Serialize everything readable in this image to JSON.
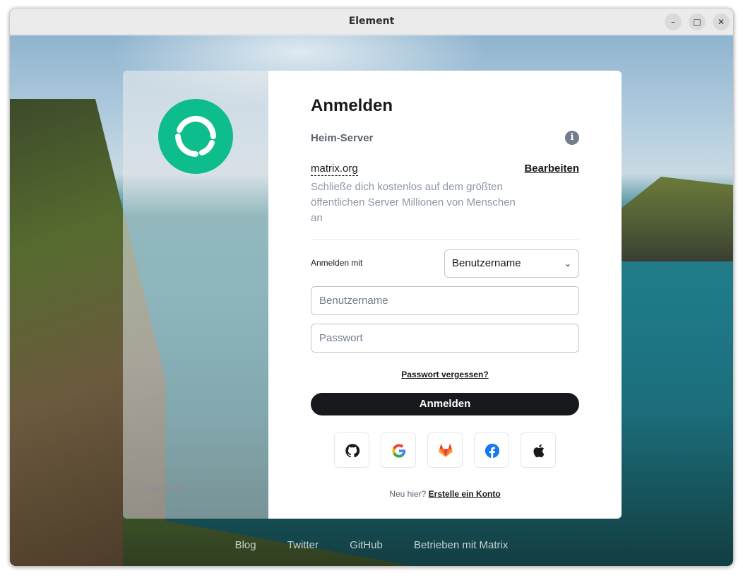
{
  "window": {
    "title": "Element",
    "minimize_glyph": "–",
    "maximize_glyph": "□",
    "close_glyph": "✕"
  },
  "sidebar": {
    "language": "Deutsch"
  },
  "login": {
    "heading": "Anmelden",
    "homeserver_label": "Heim-Server",
    "server_name": "matrix.org",
    "edit_label": "Bearbeiten",
    "server_description": "Schließe dich kostenlos auf dem größten öffentlichen Server Millionen von Menschen an",
    "login_with_label": "Anmelden mit",
    "login_with_value": "Benutzername",
    "username_placeholder": "Benutzername",
    "password_placeholder": "Passwort",
    "forgot_password": "Passwort vergessen?",
    "submit_label": "Anmelden",
    "sso_providers": [
      "github-icon",
      "google-icon",
      "gitlab-icon",
      "facebook-icon",
      "apple-icon"
    ],
    "new_here": "Neu hier?",
    "create_account": "Erstelle ein Konto"
  },
  "footer": {
    "links": [
      "Blog",
      "Twitter",
      "GitHub",
      "Betrieben mit Matrix"
    ]
  },
  "colors": {
    "brand_green": "#0dbd8b",
    "button_dark": "#17191c",
    "muted_text": "#8d97a5"
  }
}
